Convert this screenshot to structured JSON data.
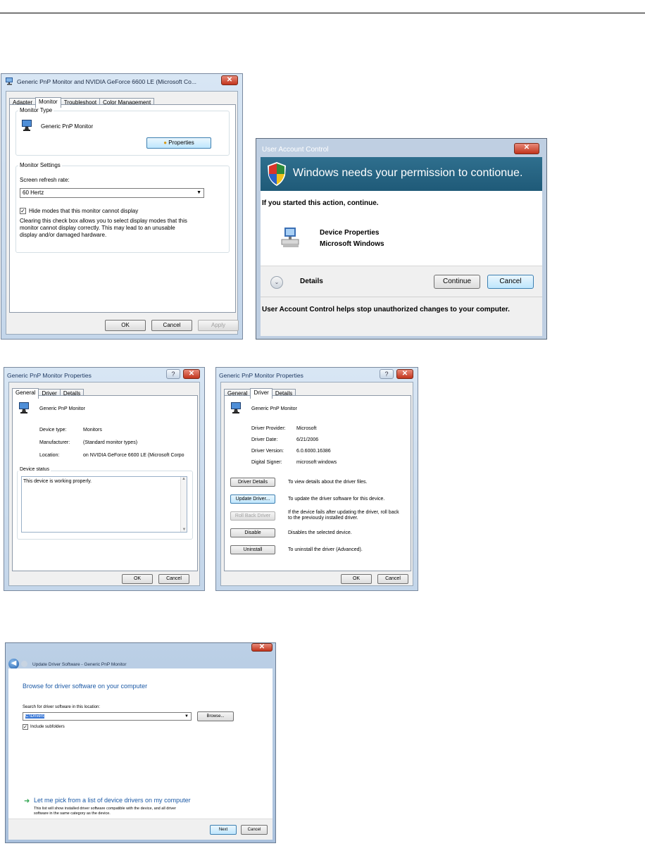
{
  "display_props": {
    "title": "Generic PnP Monitor and NVIDIA GeForce 6600 LE (Microsoft Co...",
    "close": "✕",
    "tabs": [
      "Adapter",
      "Monitor",
      "Troubleshoot",
      "Color Management"
    ],
    "monitor_type_label": "Monitor Type",
    "monitor_name": "Generic PnP Monitor",
    "properties_button": "Properties",
    "monitor_settings_label": "Monitor Settings",
    "refresh_rate_label": "Screen refresh rate:",
    "refresh_rate_value": "60 Hertz",
    "hide_modes_label": "Hide modes that this monitor cannot display",
    "hide_modes_checked": true,
    "description": [
      "Clearing this check box allows you to select display modes that this",
      "monitor cannot display correctly. This may lead to an unusable",
      "display and/or damaged hardware."
    ],
    "ok": "OK",
    "cancel": "Cancel",
    "apply": "Apply"
  },
  "uac": {
    "title": "User Account Control",
    "close": "✕",
    "banner": "Windows needs your permission to contionue.",
    "started": "If you started this action, continue.",
    "program_name": "Device Properties",
    "publisher": "Microsoft Windows",
    "details": "Details",
    "continue": "Continue",
    "cancel": "Cancel",
    "footer": "User Account Control helps stop unauthorized changes to your computer."
  },
  "general_props": {
    "title": "Generic PnP Monitor Properties",
    "help": "?",
    "close": "✕",
    "tabs": [
      "General",
      "Driver",
      "Details"
    ],
    "device_name": "Generic PnP Monitor",
    "fields": [
      {
        "label": "Device type:",
        "value": "Monitors"
      },
      {
        "label": "Manufacturer:",
        "value": "(Standard monitor types)"
      },
      {
        "label": "Location:",
        "value": "on NVIDIA GeForce 6600 LE (Microsoft Corpo"
      }
    ],
    "status_label": "Device status",
    "status_text": "This device is working properly.",
    "ok": "OK",
    "cancel": "Cancel"
  },
  "driver_props": {
    "title": "Generic PnP Monitor Properties",
    "help": "?",
    "close": "✕",
    "tabs": [
      "General",
      "Driver",
      "Details"
    ],
    "device_name": "Generic PnP Monitor",
    "fields": [
      {
        "label": "Driver Provider:",
        "value": "Microsoft"
      },
      {
        "label": "Driver Date:",
        "value": "6/21/2006"
      },
      {
        "label": "Driver Version:",
        "value": "6.0.6000.16386"
      },
      {
        "label": "Digital Signer:",
        "value": "microsoft windows"
      }
    ],
    "actions": [
      {
        "button": "Driver Details",
        "desc": "To view details about the driver files."
      },
      {
        "button": "Update Driver...",
        "desc": "To update the driver software for this device."
      },
      {
        "button": "Roll Back Driver",
        "desc": "If the device fails after updating the driver, roll back to the previously installed driver."
      },
      {
        "button": "Disable",
        "desc": "Disables the selected device."
      },
      {
        "button": "Uninstall",
        "desc": "To uninstall the driver (Advanced)."
      }
    ],
    "ok": "OK",
    "cancel": "Cancel"
  },
  "update_driver": {
    "back": "◀",
    "close": "✕",
    "title": "Update Driver Software - Generic PnP Monitor",
    "heading": "Browse for driver software on your computer",
    "search_label": "Search for driver software in this location:",
    "path_value": "C:\\Drivers",
    "browse": "Browse...",
    "include_subfolders": "Include subfolders",
    "include_checked": true,
    "pick_link": "Let me pick from a list of device drivers on my computer",
    "pick_desc_1": "This list will show installed driver software compatible with the device, and all driver",
    "pick_desc_2": "software in the same category as the device.",
    "next": "Next",
    "cancel": "Cancel"
  },
  "colors": {
    "link_blue": "#1c5aa6",
    "uac_banner": "#2f6f8e",
    "title_close": "#c2341c"
  }
}
